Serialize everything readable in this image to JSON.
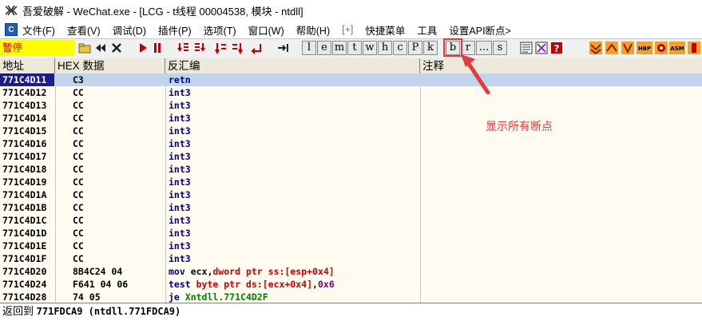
{
  "window": {
    "title": "吾爱破解 - WeChat.exe - [LCG - t线程  00004538, 模块 - ntdll]"
  },
  "menu": {
    "items": [
      "文件(F)",
      "查看(V)",
      "调试(D)",
      "插件(P)",
      "选项(T)",
      "窗口(W)",
      "帮助(H)",
      "[+]",
      "快捷菜单",
      "工具",
      "设置API断点>"
    ]
  },
  "toolbar": {
    "status": "暂停",
    "letter_buttons": [
      "l",
      "e",
      "m",
      "t",
      "w",
      "h",
      "c",
      "P",
      "k",
      "b",
      "r",
      "...",
      "s"
    ],
    "right_buttons": [
      "HBP",
      "ASM"
    ]
  },
  "columns": {
    "address": "地址",
    "hex": "HEX 数据",
    "disasm": "反汇编",
    "comment": "注释"
  },
  "rows": [
    {
      "addr": "771C4D11",
      "hex": "C3",
      "asm": "retn"
    },
    {
      "addr": "771C4D12",
      "hex": "CC",
      "asm": "int3"
    },
    {
      "addr": "771C4D13",
      "hex": "CC",
      "asm": "int3"
    },
    {
      "addr": "771C4D14",
      "hex": "CC",
      "asm": "int3"
    },
    {
      "addr": "771C4D15",
      "hex": "CC",
      "asm": "int3"
    },
    {
      "addr": "771C4D16",
      "hex": "CC",
      "asm": "int3"
    },
    {
      "addr": "771C4D17",
      "hex": "CC",
      "asm": "int3"
    },
    {
      "addr": "771C4D18",
      "hex": "CC",
      "asm": "int3"
    },
    {
      "addr": "771C4D19",
      "hex": "CC",
      "asm": "int3"
    },
    {
      "addr": "771C4D1A",
      "hex": "CC",
      "asm": "int3"
    },
    {
      "addr": "771C4D1B",
      "hex": "CC",
      "asm": "int3"
    },
    {
      "addr": "771C4D1C",
      "hex": "CC",
      "asm": "int3"
    },
    {
      "addr": "771C4D1D",
      "hex": "CC",
      "asm": "int3"
    },
    {
      "addr": "771C4D1E",
      "hex": "CC",
      "asm": "int3"
    },
    {
      "addr": "771C4D1F",
      "hex": "CC",
      "asm": "int3"
    },
    {
      "addr": "771C4D20",
      "hex": "8B4C24 04",
      "asm_parts": [
        [
          "kw",
          "mov "
        ],
        [
          "op",
          "ecx,"
        ],
        [
          "mem",
          "dword ptr ss:[esp+0x4]"
        ]
      ]
    },
    {
      "addr": "771C4D24",
      "hex": "F641 04 06",
      "asm_parts": [
        [
          "kw",
          "test "
        ],
        [
          "mem",
          "byte ptr ds:[ecx+0x4]"
        ],
        [
          "op",
          ","
        ],
        [
          "num",
          "0x6"
        ]
      ]
    },
    {
      "addr": "771C4D28",
      "hex": "74 05",
      "asm_parts": [
        [
          "kw",
          "je "
        ],
        [
          "jmp",
          "Xntdll.771C4D2F"
        ]
      ]
    }
  ],
  "info": {
    "text": "返回到",
    "value": "771FDCA9 (ntdll.771FDCA9)"
  },
  "annotation": {
    "label": "显示所有断点"
  },
  "colors": {
    "accent": "#e83a3a",
    "selection": "#1c1c8c",
    "pause_bg": "#ffff00"
  }
}
